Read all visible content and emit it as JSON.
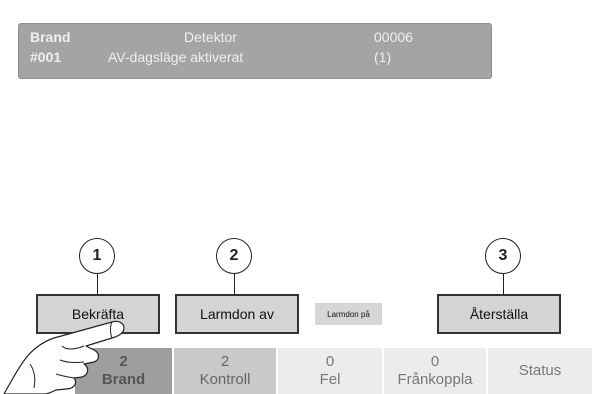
{
  "alarm": {
    "type": "Brand",
    "number": "#001",
    "source": "Detektor",
    "message": "AV-dagsläge aktiverat",
    "code": "00006",
    "count": "(1)"
  },
  "callouts": [
    "1",
    "2",
    "3"
  ],
  "buttons": {
    "acknowledge": "Bekräfta",
    "silence": "Larmdon av",
    "sound": "Larmdon på",
    "reset": "Återställa"
  },
  "tabs": [
    {
      "count": "2",
      "label": "Brand"
    },
    {
      "count": "2",
      "label": "Kontroll"
    },
    {
      "count": "0",
      "label": "Fel"
    },
    {
      "count": "0",
      "label": "Frånkoppla"
    },
    {
      "count": "",
      "label": "Status"
    }
  ],
  "colors": {
    "panel": "#a4a4a4",
    "button": "#d4d4d4",
    "tab_fire": "#9e9e9e",
    "tab_control": "#c9c9c9",
    "tab_default": "#ececec"
  }
}
